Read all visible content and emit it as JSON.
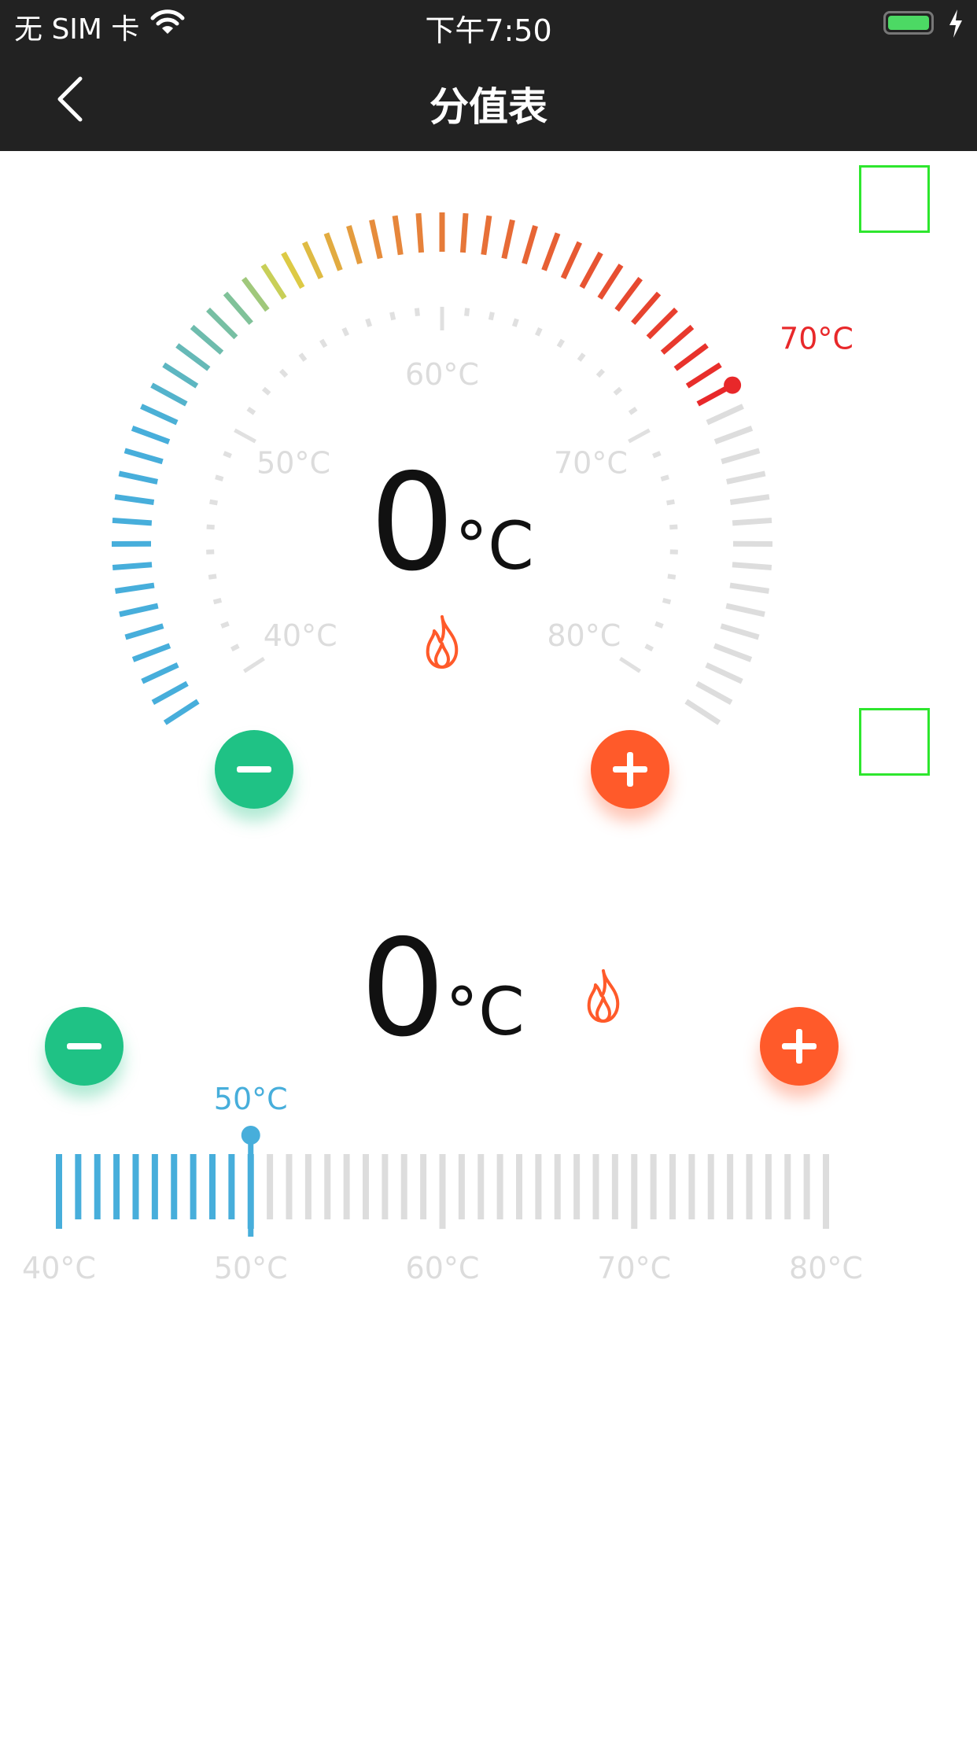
{
  "status_bar": {
    "carrier": "无 SIM 卡",
    "time": "下午7:50",
    "battery_color": "#4cd964"
  },
  "nav": {
    "title": "分值表",
    "back_icon": "chevron-left-icon"
  },
  "dial_gauge": {
    "temperature": "0",
    "unit": "°C",
    "setpoint_label": "70°C",
    "setpoint_value": 70,
    "range": [
      40,
      80
    ],
    "tick_labels": [
      "40°C",
      "50°C",
      "60°C",
      "70°C",
      "80°C"
    ],
    "flame_icon": "flame-icon",
    "active_color_start": "#47aedb",
    "active_color_end": "#e8282a",
    "inactive_color": "#dddddd"
  },
  "linear_gauge": {
    "temperature": "0",
    "unit": "°C",
    "setpoint_label": "50°C",
    "setpoint_value": 50,
    "range": [
      40,
      80
    ],
    "tick_labels": [
      "40°C",
      "50°C",
      "60°C",
      "70°C",
      "80°C"
    ],
    "active_color": "#47aedb",
    "inactive_color": "#dddddd",
    "flame_icon": "flame-icon"
  },
  "buttons": {
    "minus_color": "#1fc285",
    "plus_color": "#ff5a2a"
  }
}
